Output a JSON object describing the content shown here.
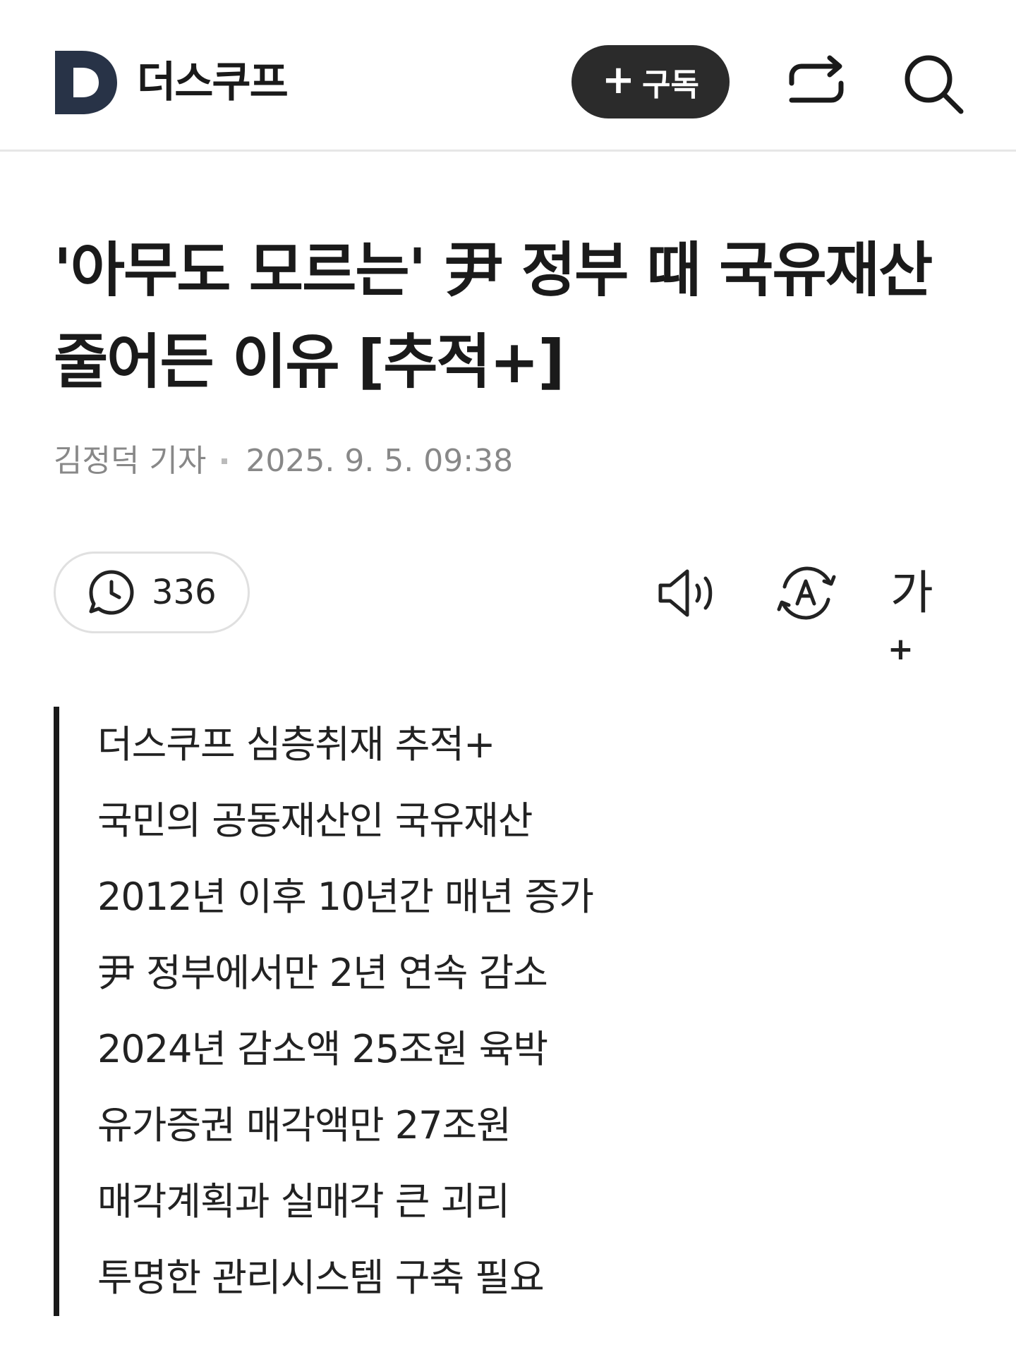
{
  "header": {
    "brand": "더스쿠프",
    "logo_letter": "D",
    "subscribe_label": "구독",
    "subscribe_prefix": "+"
  },
  "article": {
    "title": "'아무도 모르는' 尹 정부 때 국유재산 줄어든 이유 [추적+]",
    "author": "김정덕 기자",
    "date": "2025. 9. 5. 09:38",
    "views": "336",
    "font_size_label": "가",
    "font_size_plus": "+",
    "summary": [
      "더스쿠프 심층취재 추적+",
      "국민의 공동재산인 국유재산",
      "2012년 이후 10년간 매년 증가",
      "尹 정부에서만 2년 연속 감소",
      "2024년 감소액 25조원 육박",
      "유가증권 매각액만 27조원",
      "매각계획과 실매각 큰 괴리",
      "투명한 관리시스템 구축 필요"
    ]
  },
  "icons": {
    "share": "share-icon",
    "search": "search-icon",
    "views": "clock-chat-icon",
    "audio": "speaker-icon",
    "translate": "translate-icon"
  },
  "colors": {
    "brand_dark": "#283347",
    "button_bg": "#2b2b2b",
    "muted_text": "#888888",
    "quote_bar": "#1a1a1a"
  }
}
